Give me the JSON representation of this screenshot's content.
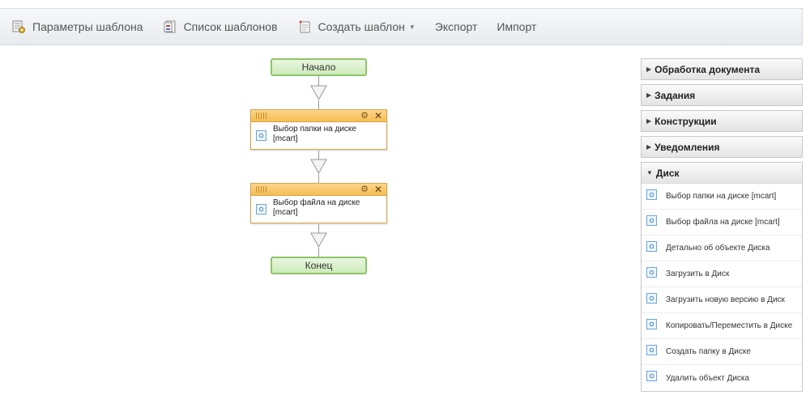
{
  "toolbar": {
    "params_label": "Параметры шаблона",
    "list_label": "Список шаблонов",
    "create_label": "Создать шаблон",
    "export_label": "Экспорт",
    "import_label": "Импорт"
  },
  "flow": {
    "start_label": "Начало",
    "end_label": "Конец",
    "activities": [
      {
        "label": "Выбор папки на диске [mcart]"
      },
      {
        "label": "Выбор файла на диске [mcart]"
      }
    ]
  },
  "panel": {
    "sections": [
      {
        "label": "Обработка документа"
      },
      {
        "label": "Задания"
      },
      {
        "label": "Конструкции"
      },
      {
        "label": "Уведомления"
      }
    ],
    "disk": {
      "label": "Диск",
      "items": [
        "Выбор папки на диске [mcart]",
        "Выбор файла на диске [mcart]",
        "Детально об объекте Диска",
        "Загрузить в Диск",
        "Загрузить новую версию в Диск",
        "Копировать/Переместить в Диске",
        "Создать папку в Диске",
        "Удалить объект Диска"
      ]
    }
  },
  "colors": {
    "terminal_border": "#8dc46a",
    "activity_header": "#f6bd55",
    "icon_blue": "#6aa6d8"
  }
}
